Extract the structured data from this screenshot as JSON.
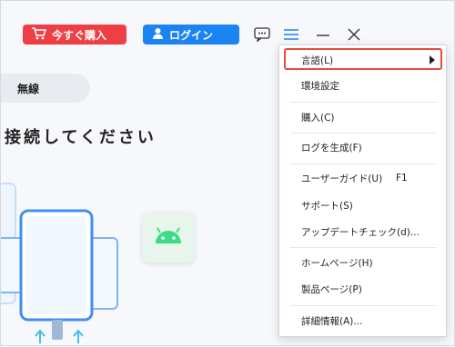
{
  "header": {
    "buy_label": "今すぐ購入",
    "login_label": "ログイン"
  },
  "tabs": {
    "wireless_label": "無線"
  },
  "main": {
    "connect_prompt": "接続してください"
  },
  "menu": {
    "items": [
      {
        "label": "言語(L)",
        "shortcut": ""
      },
      {
        "label": "環境設定",
        "shortcut": ""
      },
      {
        "label": "購入(C)",
        "shortcut": ""
      },
      {
        "label": "ログを生成(F)",
        "shortcut": ""
      },
      {
        "label": "ユーザーガイド(U)",
        "shortcut": "F1"
      },
      {
        "label": "サポート(S)",
        "shortcut": ""
      },
      {
        "label": "アップデートチェック(d)...",
        "shortcut": ""
      },
      {
        "label": "ホームページ(H)",
        "shortcut": ""
      },
      {
        "label": "製品ページ(P)",
        "shortcut": ""
      },
      {
        "label": "詳細情報(A)...",
        "shortcut": ""
      }
    ]
  },
  "colors": {
    "buy_button": "#ef3f44",
    "login_button": "#1c84f2",
    "highlight_border": "#e84a3c",
    "android_green": "#3ddc84"
  },
  "icons": [
    "cart-icon",
    "user-icon",
    "chat-icon",
    "menu-icon",
    "minimize-icon",
    "close-icon",
    "submenu-arrow-icon",
    "android-icon",
    "upload-arrow-icon"
  ]
}
